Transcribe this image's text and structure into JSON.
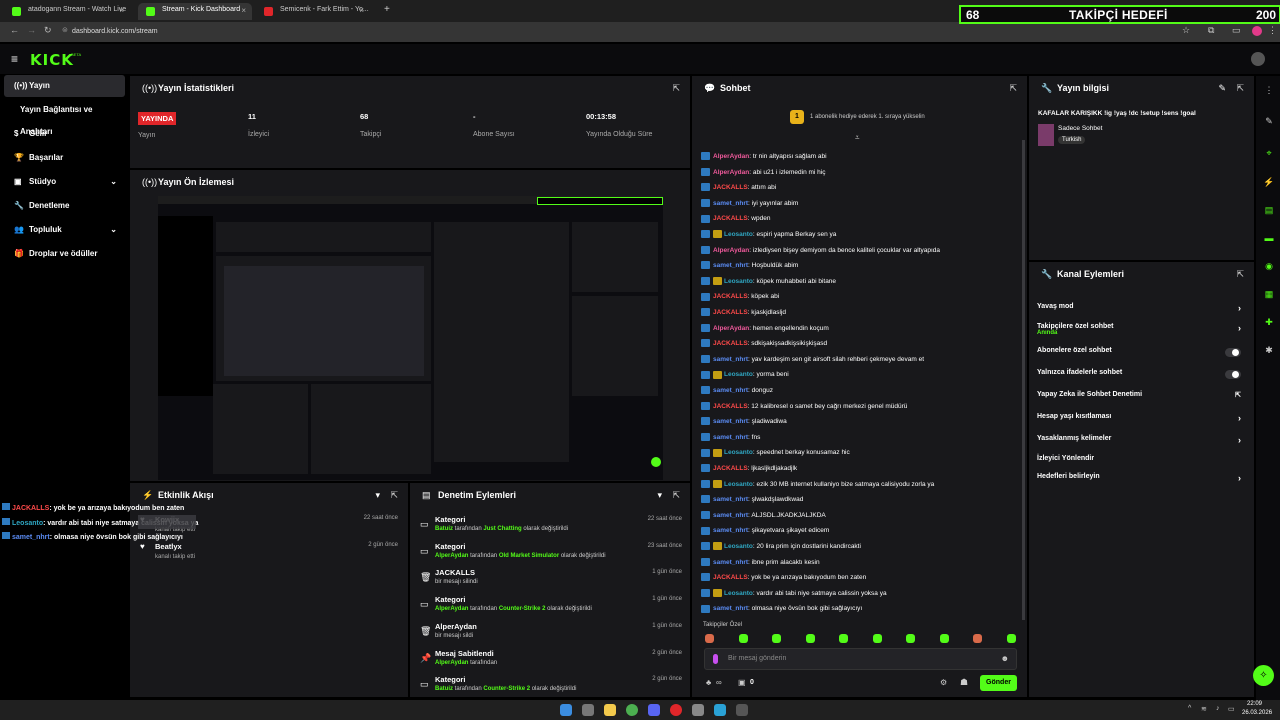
{
  "browser": {
    "tabs": [
      {
        "title": "atadogann Stream - Watch Live",
        "fav": "#53fc18"
      },
      {
        "title": "Stream - Kick Dashboard",
        "fav": "#53fc18"
      },
      {
        "title": "Semicenk - Fark Ettim - Yo...",
        "fav": "#e0262a"
      }
    ],
    "url": "dashboard.kick.com/stream",
    "new_tab": "+"
  },
  "goal": {
    "current": "68",
    "title": "TAKİPÇİ HEDEFİ",
    "target": "200",
    "progress": 0.34
  },
  "app": {
    "logo": "KICK",
    "logo_tag": "BETA"
  },
  "sidebar": {
    "items": [
      {
        "label": "Yayın",
        "icon": "broadcast-icon"
      },
      {
        "label": "Yayın Bağlantısı ve Anahtarı",
        "icon": ""
      },
      {
        "label": "Gelir",
        "icon": "dollar-icon"
      },
      {
        "label": "Başarılar",
        "icon": "trophy-icon"
      },
      {
        "label": "Stüdyo",
        "icon": "studio-icon"
      },
      {
        "label": "Denetleme",
        "icon": "wrench-icon"
      },
      {
        "label": "Topluluk",
        "icon": "people-icon"
      },
      {
        "label": "Droplar ve ödüller",
        "icon": "gift-icon"
      }
    ]
  },
  "stats": {
    "title": "Yayın İstatistikleri",
    "items": [
      {
        "value": "YAYINDA",
        "label": "Yayın"
      },
      {
        "value": "11",
        "label": "İzleyici"
      },
      {
        "value": "68",
        "label": "Takipçi"
      },
      {
        "value": "-",
        "label": "Abone Sayısı"
      },
      {
        "value": "00:13:58",
        "label": "Yayında Olduğu Süre"
      }
    ]
  },
  "preview": {
    "title": "Yayın Ön İzlemesi"
  },
  "activity": {
    "title": "Etkinlik Akışı",
    "items": [
      {
        "name": "Kowjix",
        "sub": "kanalı takip etti",
        "time": "22 saat önce"
      },
      {
        "name": "Beatlyx",
        "sub": "kanalı takip etti",
        "time": "2 gün önce"
      }
    ]
  },
  "mod": {
    "title": "Denetim Eylemleri",
    "items": [
      {
        "name": "Kategori",
        "who": "Batuiz",
        "mid": " tarafından ",
        "what": "Just Chatting",
        "end": " olarak değiştirildi",
        "time": "22 saat önce"
      },
      {
        "name": "Kategori",
        "who": "AlperAydan",
        "mid": " tarafından ",
        "what": "Old Market Simulator",
        "end": " olarak değiştirildi",
        "time": "23 saat önce"
      },
      {
        "name": "JACKALLS",
        "who": "",
        "mid": "bir mesajı silindi",
        "what": "",
        "end": "",
        "time": "1 gün önce"
      },
      {
        "name": "Kategori",
        "who": "AlperAydan",
        "mid": " tarafından ",
        "what": "Counter-Strike 2",
        "end": " olarak değiştirildi",
        "time": "1 gün önce"
      },
      {
        "name": "AlperAydan",
        "who": "",
        "mid": "bir mesajı sildi",
        "what": "",
        "end": "",
        "time": "1 gün önce"
      },
      {
        "name": "Mesaj Sabitlendi",
        "who": "AlperAydan",
        "mid": " tarafından",
        "what": "",
        "end": "",
        "time": "2 gün önce"
      },
      {
        "name": "Kategori",
        "who": "Batuiz",
        "mid": " tarafından ",
        "what": "Counter-Strike 2",
        "end": " olarak değiştirildi",
        "time": "2 gün önce"
      }
    ]
  },
  "chat": {
    "title": "Sohbet",
    "gift_banner": "1 abonelik hediye ederek 1. sıraya yükselin",
    "messages": [
      {
        "user": "AlperAydan",
        "c": "u-pink",
        "g": false,
        "text": "tr nin altyapısı sağlam abi"
      },
      {
        "user": "AlperAydan",
        "c": "u-pink",
        "g": false,
        "text": "abi u21 i izlemedin mi hiç"
      },
      {
        "user": "JACKALLS",
        "c": "u-red",
        "g": false,
        "text": "attım abi"
      },
      {
        "user": "samet_nhrt",
        "c": "u-blue",
        "g": false,
        "text": "iyi yayınlar abim"
      },
      {
        "user": "JACKALLS",
        "c": "u-red",
        "g": false,
        "text": "wpden"
      },
      {
        "user": "Leosanto",
        "c": "u-teal",
        "g": true,
        "text": "espiri yapma Berkay sen ya"
      },
      {
        "user": "AlperAydan",
        "c": "u-pink",
        "g": false,
        "text": "izlediysen bişey demiyom da bence kaliteli çocuklar var altyapıda"
      },
      {
        "user": "samet_nhrt",
        "c": "u-blue",
        "g": false,
        "text": "Hoşbuldük abim"
      },
      {
        "user": "Leosanto",
        "c": "u-teal",
        "g": true,
        "text": "köpek muhabbeti abi bitane"
      },
      {
        "user": "JACKALLS",
        "c": "u-red",
        "g": false,
        "text": "köpek abi"
      },
      {
        "user": "JACKALLS",
        "c": "u-red",
        "g": false,
        "text": "kjaskjdlasljd"
      },
      {
        "user": "AlperAydan",
        "c": "u-pink",
        "g": false,
        "text": "hemen engellendin koçum"
      },
      {
        "user": "JACKALLS",
        "c": "u-red",
        "g": false,
        "text": "sdkişakişsadkişsikişkişasd"
      },
      {
        "user": "samet_nhrt",
        "c": "u-blue",
        "g": false,
        "text": "yav kardeşim sen git airsoft silah rehberi çekmeye devam et"
      },
      {
        "user": "Leosanto",
        "c": "u-teal",
        "g": true,
        "text": "yorma beni"
      },
      {
        "user": "samet_nhrt",
        "c": "u-blue",
        "g": false,
        "text": "donguz"
      },
      {
        "user": "JACKALLS",
        "c": "u-red",
        "g": false,
        "text": "12 kalibresel o samet bey cağrı merkezi genel müdürü"
      },
      {
        "user": "samet_nhrt",
        "c": "u-blue",
        "g": false,
        "text": "şladiwadiwa"
      },
      {
        "user": "samet_nhrt",
        "c": "u-blue",
        "g": false,
        "text": "fns"
      },
      {
        "user": "Leosanto",
        "c": "u-teal",
        "g": true,
        "text": "speednet berkay konusamaz hic"
      },
      {
        "user": "JACKALLS",
        "c": "u-red",
        "g": false,
        "text": "ljkasljkdljakadjlk"
      },
      {
        "user": "Leosanto",
        "c": "u-teal",
        "g": true,
        "text": "ezik 30 MB internet kullaniyo bize satmaya calisiyodu zorla ya"
      },
      {
        "user": "samet_nhrt",
        "c": "u-blue",
        "g": false,
        "text": "şlwakdşlawdkwad"
      },
      {
        "user": "samet_nhrt",
        "c": "u-blue",
        "g": false,
        "text": "ALJSDL.JKADKJALJKDA"
      },
      {
        "user": "samet_nhrt",
        "c": "u-blue",
        "g": false,
        "text": "şikayetvara şikayet edicem"
      },
      {
        "user": "Leosanto",
        "c": "u-teal",
        "g": true,
        "text": "20 lira prim için dostlarini kandircakti"
      },
      {
        "user": "samet_nhrt",
        "c": "u-blue",
        "g": false,
        "text": "ibne prim alacaktı kesin"
      },
      {
        "user": "JACKALLS",
        "c": "u-red",
        "g": false,
        "text": "yok be ya arızaya bakıyodum ben zaten"
      },
      {
        "user": "Leosanto",
        "c": "u-teal",
        "g": true,
        "text": "vardır abi tabi niye satmaya calissin yoksa ya"
      },
      {
        "user": "samet_nhrt",
        "c": "u-blue",
        "g": false,
        "text": "olmasa niye övsün bok gibi sağlayıcıyı"
      }
    ],
    "followers_only": "Takipçiler Özel",
    "input_placeholder": "Bir mesaj gönderin",
    "send_label": "Gönder",
    "points": "∞",
    "count": "0"
  },
  "stream_info": {
    "title": "Yayın bilgisi",
    "stream_title": "KAFALAR KARIŞIKK !ig !yaş !dc !setup !sens !goal",
    "category": "Sadece Sohbet",
    "language": "Turkish"
  },
  "channel_actions": {
    "title": "Kanal Eylemleri",
    "items": [
      {
        "label": "Yavaş mod",
        "kind": "chev",
        "sub": ""
      },
      {
        "label": "Takipçilere özel sohbet",
        "kind": "chev",
        "sub": "Anında"
      },
      {
        "label": "Abonelere özel sohbet",
        "kind": "toggle",
        "sub": ""
      },
      {
        "label": "Yalnızca ifadelerle sohbet",
        "kind": "toggle",
        "sub": ""
      },
      {
        "label": "Yapay Zeka ile Sohbet Denetimi",
        "kind": "ext",
        "sub": ""
      },
      {
        "label": "Hesap yaşı kısıtlaması",
        "kind": "chev",
        "sub": ""
      },
      {
        "label": "Yasaklanmış kelimeler",
        "kind": "chev",
        "sub": ""
      },
      {
        "label": "İzleyici Yönlendir",
        "kind": "none",
        "sub": ""
      },
      {
        "label": "Hedefleri belirleyin",
        "kind": "chev",
        "sub": ""
      }
    ]
  },
  "overlay_chat": [
    {
      "user": "JACKALLS",
      "c": "u-red",
      "text": ": yok be ya arızaya bakıyodum ben zaten"
    },
    {
      "user": "Leosanto",
      "c": "u-teal",
      "text": ": vardır abi tabi niye satmaya calissin yoksa ya"
    },
    {
      "user": "samet_nhrt",
      "c": "u-blue",
      "text": ": olmasa niye övsün bok gibi sağlayıcıyı"
    }
  ],
  "clock": {
    "time": "22:09",
    "date": "26.03.2026"
  }
}
